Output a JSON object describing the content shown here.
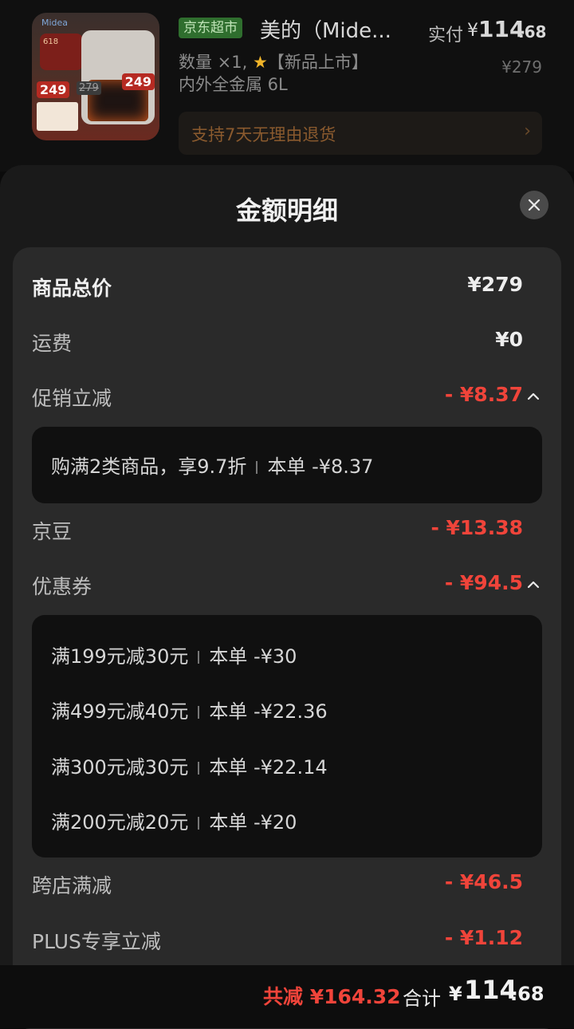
{
  "product": {
    "store_badge": "京东超市",
    "title": "美的（Mide...",
    "actual_label": "实付",
    "actual_currency": "¥",
    "actual_int": "114",
    "actual_dec": ".68",
    "qty_text": "数量 ×1,",
    "tag_text": "【新品上市】",
    "spec_text": "内外全金属 6L",
    "original_price": "¥279",
    "return_policy": "支持7天无理由退货",
    "image": {
      "brand": "Midea",
      "badge": "618",
      "price_a": "249",
      "price_b": "279",
      "price_c": "249"
    }
  },
  "sheet": {
    "title": "金额明细",
    "rows": {
      "goods_total": {
        "label": "商品总价",
        "value": "¥279"
      },
      "shipping": {
        "label": "运费",
        "value": "¥0"
      },
      "promo": {
        "label": "促销立减",
        "value": "- ¥8.37"
      },
      "jingdou": {
        "label": "京豆",
        "value": "- ¥13.38"
      },
      "coupon": {
        "label": "优惠券",
        "value": "- ¥94.5"
      },
      "cross_store": {
        "label": "跨店满减",
        "value": "- ¥46.5"
      },
      "plus": {
        "label": "PLUS专享立减",
        "value": "- ¥1.12"
      }
    },
    "promo_details": [
      {
        "desc": "购满2类商品，享9.7折",
        "amount": "本单 -¥8.37"
      }
    ],
    "coupon_details": [
      {
        "desc": "满199元减30元",
        "amount": "本单 -¥30"
      },
      {
        "desc": "满499元减40元",
        "amount": "本单 -¥22.36"
      },
      {
        "desc": "满300元减30元",
        "amount": "本单 -¥22.14"
      },
      {
        "desc": "满200元减20元",
        "amount": "本单 -¥20"
      }
    ]
  },
  "bottom": {
    "reduce_text": "共减 ¥164.32",
    "total_label": "合计",
    "total_currency": "¥",
    "total_int": "114",
    "total_dec": ".68"
  },
  "colors": {
    "accent_red": "#f0443a",
    "store_green": "#2f6e2e",
    "sheet_bg": "#1a1a1a"
  }
}
